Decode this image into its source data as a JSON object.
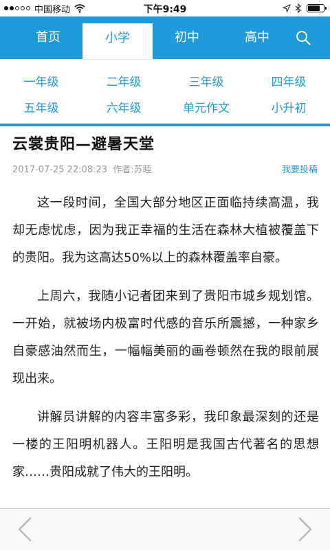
{
  "status_bar": {
    "carrier": "中国移动",
    "time": "下午9:49",
    "battery_level": 0.85,
    "signal_bars": 2
  },
  "nav": {
    "tabs": [
      "首页",
      "小学",
      "初中",
      "高中"
    ],
    "active_tab": "小学",
    "search_icon": "search-icon",
    "accent_color": "#1f9ad8"
  },
  "grades": [
    "一年级",
    "二年级",
    "三年级",
    "四年级",
    "五年级",
    "六年级",
    "单元作文",
    "小升初"
  ],
  "article": {
    "title": "云裳贵阳—避暑天堂",
    "date": "2017-07-25 22:08:23",
    "author": "作者:苏睦",
    "submit_label": "我要投稿",
    "paragraphs": [
      "这一段时间，全国大部分地区正面临持续高温，我却无虑忧虑，因为我正幸福的生活在森林大植被覆盖下的贵阳。我为这高达50%以上的森林覆盖率自豪。",
      "上周六，我随小记者团来到了贵阳市城乡规划馆。一开始，就被场内极富时代感的音乐所震撼，一种家乡自豪感油然而生，一幅幅美丽的画卷顿然在我的眼前展现出来。",
      "讲解员讲解的内容丰富多彩，我印象最深刻的还是一楼的王阳明机器人。王阳明是我国古代著名的思想家……贵阳成就了伟大的王阳明。"
    ]
  },
  "toolbar": {
    "back_icon": "chevron-left-icon",
    "forward_icon": "chevron-right-icon"
  }
}
